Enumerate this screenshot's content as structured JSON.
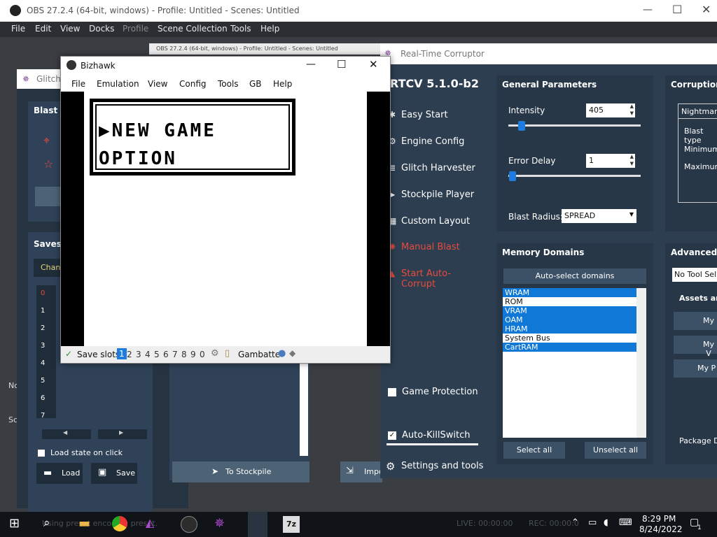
{
  "obs": {
    "title": "OBS 27.2.4 (64-bit, windows) - Profile: Untitled - Scenes: Untitled",
    "menu": [
      "File",
      "Edit",
      "View",
      "Docks",
      "Profile",
      "Scene Collection",
      "Tools",
      "Help"
    ],
    "preview_title": "OBS 27.2.4 (64-bit, windows) - Profile: Untitled - Scenes: Untitled"
  },
  "glitch_harvester": {
    "title": "Glitch",
    "blast_tools": "Blast To",
    "savestates": "Savesta",
    "change_label": "Chan",
    "slot_numbers": [
      "0",
      "1",
      "2",
      "3",
      "4",
      "5",
      "6",
      "7"
    ],
    "load_on_click": "Load state on click",
    "load_button": "Load",
    "save_button": "Save",
    "to_stockpile": "To Stockpile",
    "import_button": "Impo",
    "left_cut1": "No",
    "left_cut2": "Sc"
  },
  "bizhawk": {
    "title": "Bizhawk",
    "menu": [
      "File",
      "Emulation",
      "View",
      "Config",
      "Tools",
      "GB",
      "Help"
    ],
    "screen": {
      "line1": "▶NEW GAME",
      "line2": " OPTION"
    },
    "status": {
      "save_slots": "Save slots",
      "slots": [
        "1",
        "2",
        "3",
        "4",
        "5",
        "6",
        "7",
        "8",
        "9",
        "0"
      ],
      "core": "Gambatte"
    }
  },
  "rtcv": {
    "title": "Real-Time Corruptor",
    "version": "RTCV 5.1.0-b2",
    "nav": [
      "Easy Start",
      "Engine Config",
      "Glitch Harvester",
      "Stockpile Player",
      "Custom Layout",
      "Manual Blast",
      "Start Auto-Corrupt"
    ],
    "game_protection": "Game Protection",
    "auto_killswitch": "Auto-KillSwitch",
    "settings_tools": "Settings and tools",
    "general_parameters": {
      "title": "General Parameters",
      "intensity_label": "Intensity",
      "intensity_value": "405",
      "error_delay_label": "Error Delay",
      "error_delay_value": "1",
      "blast_radius_label": "Blast Radius:",
      "blast_radius_value": "SPREAD"
    },
    "memory_domains": {
      "title": "Memory Domains",
      "auto_select": "Auto-select domains",
      "items": [
        {
          "label": "WRAM",
          "selected": true
        },
        {
          "label": "ROM",
          "selected": false
        },
        {
          "label": "VRAM",
          "selected": true
        },
        {
          "label": "OAM",
          "selected": true
        },
        {
          "label": "HRAM",
          "selected": true
        },
        {
          "label": "System Bus",
          "selected": false
        },
        {
          "label": "CartRAM",
          "selected": true
        }
      ],
      "select_all": "Select all",
      "unselect_all": "Unselect all"
    },
    "corruption_engine": {
      "title": "Corruption E",
      "engine": "Nightmare",
      "blast_type": "Blast type",
      "minimum": "Minimum",
      "maximum": "Maximum"
    },
    "advanced_tools": {
      "title": "Advanced To",
      "dropdown": "No Tool Sel",
      "assets": "Assets and",
      "my1": "My",
      "my2": "My V",
      "my3": "My P",
      "package": "Package D"
    }
  },
  "taskbar": {
    "status_text": "Using preset encoding preset.",
    "live": "LIVE: 00:00:00",
    "rec": "REC: 00:00:0",
    "time": "8:29 PM",
    "date": "8/24/2022",
    "notifications": "1"
  }
}
